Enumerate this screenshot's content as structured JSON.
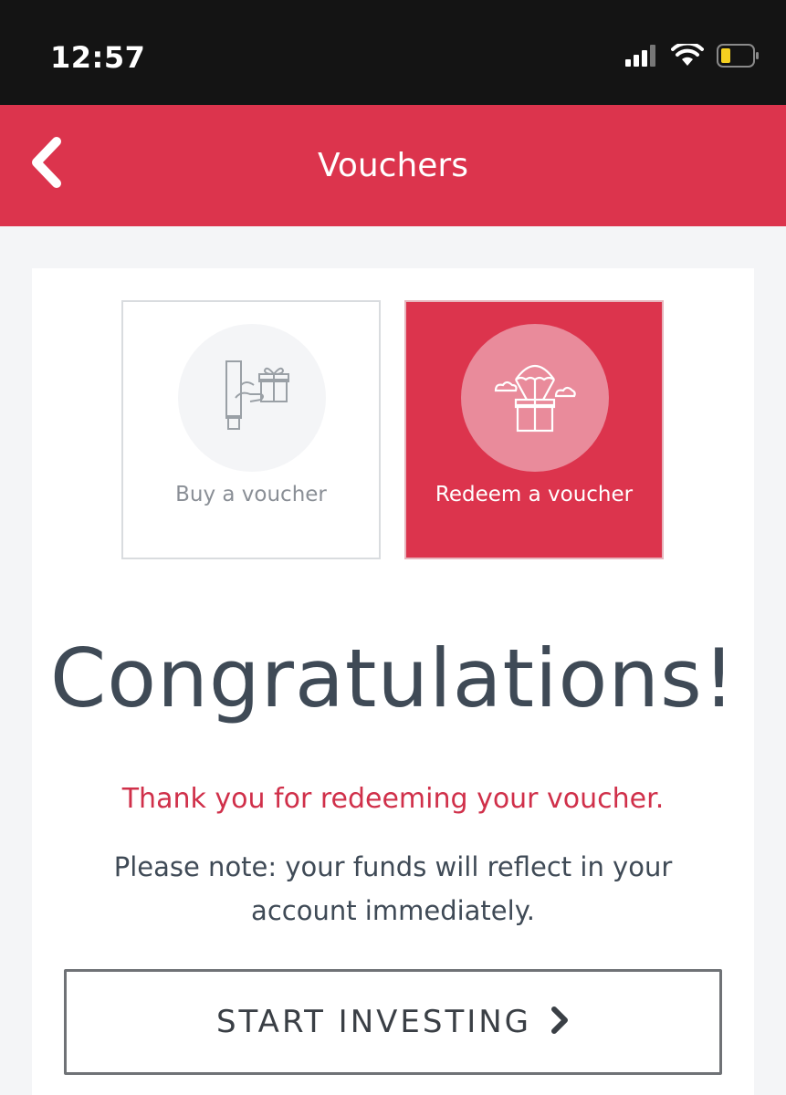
{
  "status_bar": {
    "time": "12:57",
    "icons": [
      "signal-icon",
      "wifi-icon",
      "battery-icon"
    ]
  },
  "header": {
    "title": "Vouchers",
    "back_icon": "chevron-left-icon"
  },
  "tiles": [
    {
      "label": "Buy a voucher",
      "icon": "hand-gift-icon",
      "selected": false
    },
    {
      "label": "Redeem a voucher",
      "icon": "parachute-gift-icon",
      "selected": true
    }
  ],
  "message": {
    "headline": "Congratulations!",
    "thanks": "Thank you for redeeming your voucher.",
    "note": "Please note: your funds will reflect in your account immediately."
  },
  "cta": {
    "label": "START INVESTING",
    "icon": "chevron-right-icon"
  },
  "colors": {
    "brand": "#dc344d",
    "text_dark": "#3f4a56",
    "status_bar": "#141414"
  }
}
